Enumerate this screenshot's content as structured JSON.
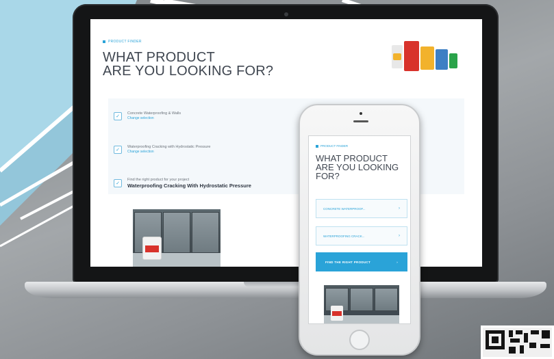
{
  "laptop_page": {
    "breadcrumb": "PRODUCT FINDER",
    "title_line1": "WHAT PRODUCT",
    "title_line2": "ARE YOU LOOKING FOR?",
    "options": [
      {
        "label": "Concrete Waterproofing & Walls",
        "sub": "Change selection"
      },
      {
        "label": "Waterproofing Cracking with Hydrostatic Pressure",
        "sub": "Change selection"
      }
    ],
    "final_prompt": "Find the right product for your project",
    "final_selection": "Waterproofing Cracking With Hydrostatic Pressure"
  },
  "mobile_page": {
    "breadcrumb": "PRODUCT FINDER",
    "title_line1": "WHAT PRODUCT",
    "title_line2": "ARE YOU LOOKING",
    "title_line3": "FOR?",
    "select1": "CONCRETE WATERPROOF...",
    "select2": "WATERPROOFING CRACK...",
    "button_label": "FIND THE RIGHT PRODUCT",
    "chevron": "›"
  },
  "colors": {
    "accent": "#2aa3d8",
    "title": "#3f4650",
    "panel": "#f4f8fb"
  },
  "icons": {
    "option_icon": "check-icon",
    "chevron_icon": "chevron-right-icon"
  }
}
